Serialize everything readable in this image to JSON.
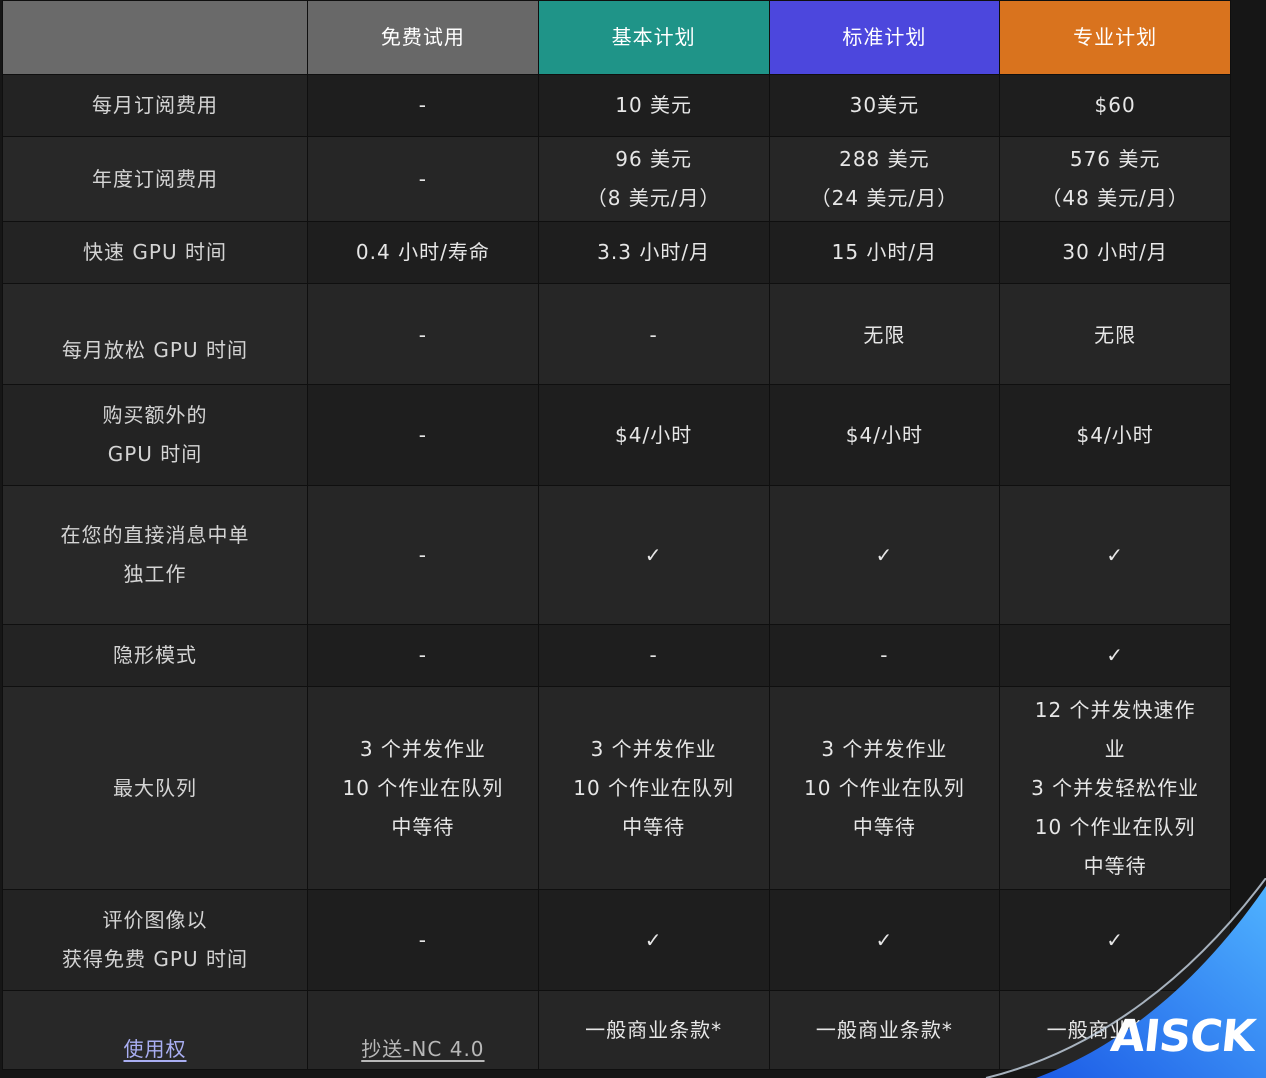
{
  "plans": [
    {
      "name": "免费试用",
      "color": "#686868"
    },
    {
      "name": "基本计划",
      "color": "#1f9488"
    },
    {
      "name": "标准计划",
      "color": "#4c47dd"
    },
    {
      "name": "专业计划",
      "color": "#d9731e"
    }
  ],
  "rows": [
    {
      "label": "每月订阅费用",
      "values": [
        "-",
        "10 美元",
        "30美元",
        "$60"
      ]
    },
    {
      "label": "年度订阅费用",
      "values": [
        "-",
        "96 美元\n（8 美元/月）",
        "288 美元\n（24 美元/月）",
        "576 美元\n（48 美元/月）"
      ]
    },
    {
      "label": "快速 GPU 时间",
      "values": [
        "0.4 小时/寿命",
        "3.3 小时/月",
        "15 小时/月",
        "30 小时/月"
      ]
    },
    {
      "label": "每月放松 GPU 时间",
      "values": [
        "-",
        "-",
        "无限",
        "无限"
      ]
    },
    {
      "label": "购买额外的\nGPU 时间",
      "values": [
        "-",
        "$4/小时",
        "$4/小时",
        "$4/小时"
      ]
    },
    {
      "label": "在您的直接消息中单\n独工作",
      "values": [
        "-",
        "✓",
        "✓",
        "✓"
      ]
    },
    {
      "label": "隐形模式",
      "values": [
        "-",
        "-",
        "-",
        "✓"
      ]
    },
    {
      "label": "最大队列",
      "values": [
        "3 个并发作业\n10 个作业在队列\n中等待",
        "3 个并发作业\n10 个作业在队列\n中等待",
        "3 个并发作业\n10 个作业在队列\n中等待",
        "12 个并发快速作\n业\n3 个并发轻松作业\n10 个作业在队列\n中等待"
      ]
    },
    {
      "label": "评价图像以\n获得免费 GPU 时间",
      "values": [
        "-",
        "✓",
        "✓",
        "✓"
      ]
    }
  ],
  "license": {
    "label": "使用权",
    "values": [
      "抄送-NC 4.0",
      "一般商业条款*",
      "一般商业条款*",
      "一般商业条款*"
    ]
  },
  "watermark": {
    "text": "AISCK"
  }
}
